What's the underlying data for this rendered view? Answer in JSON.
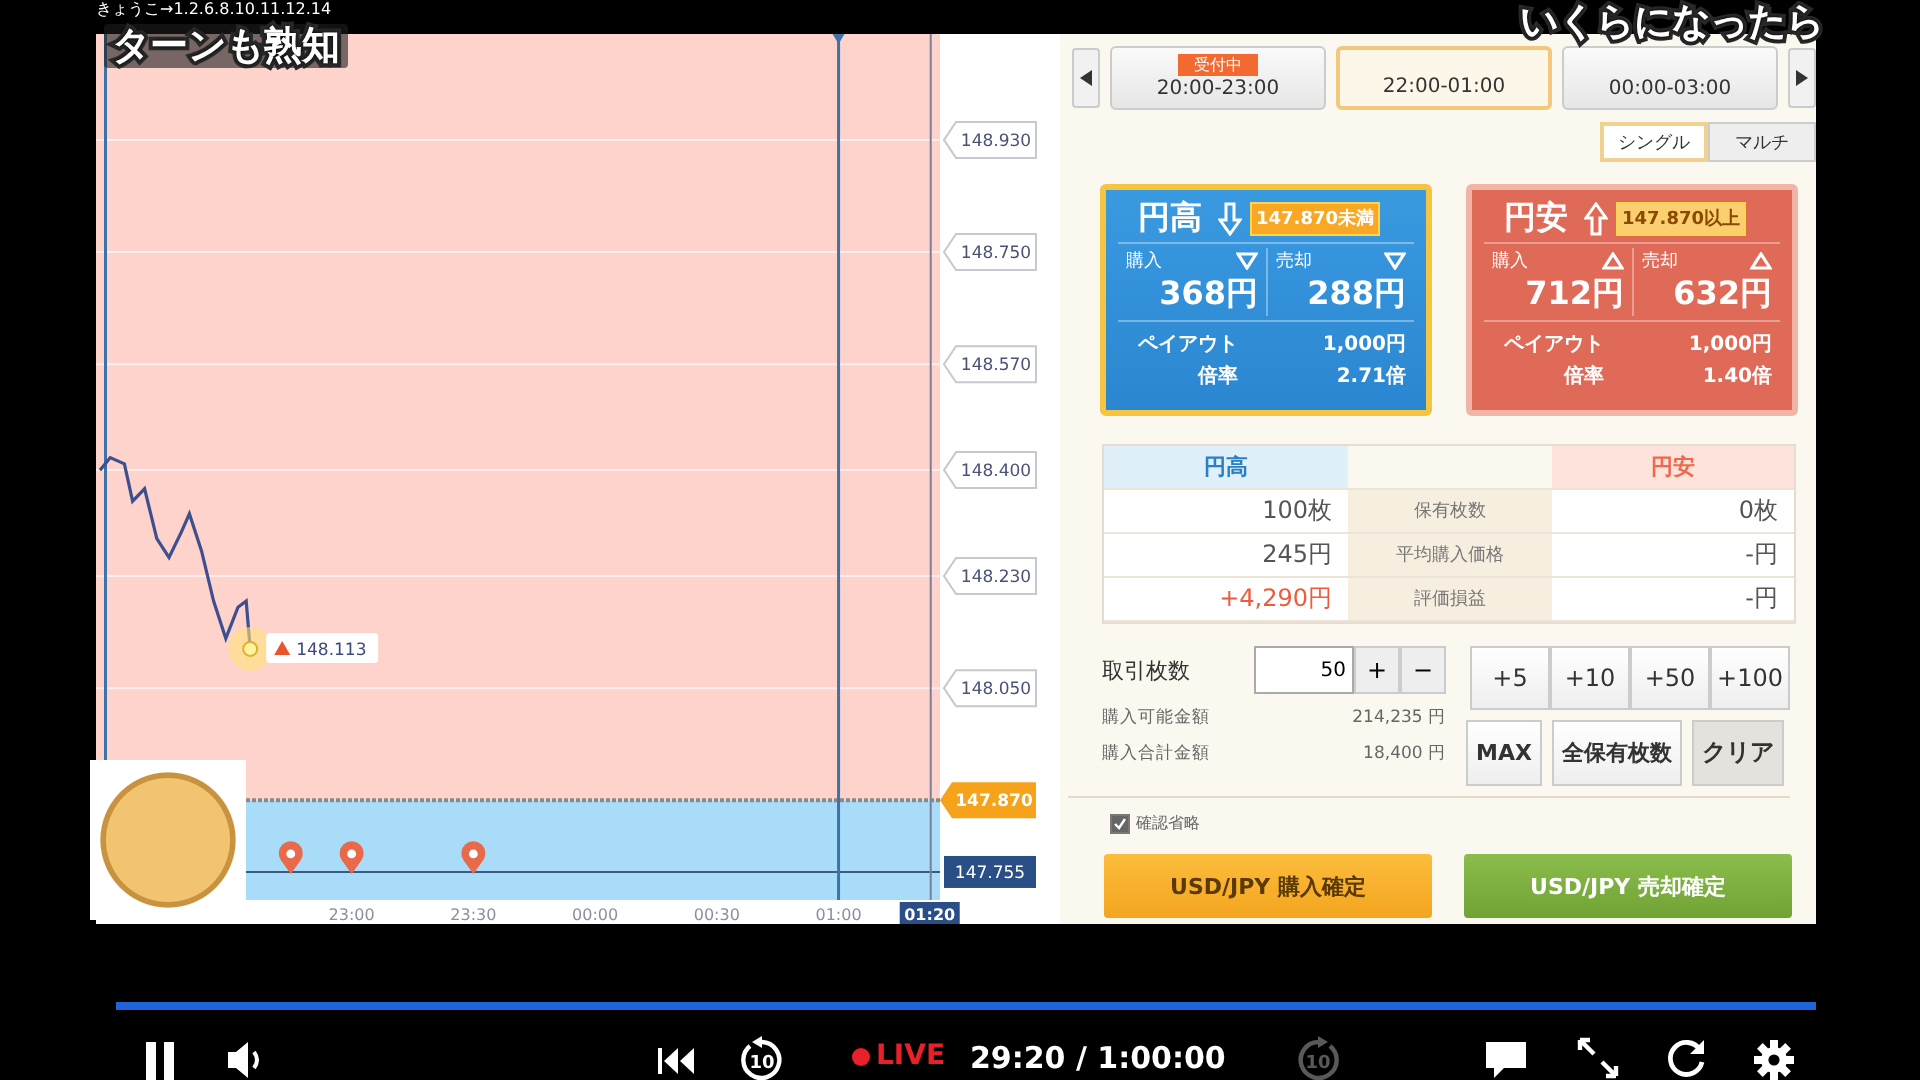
{
  "header_text": "きょうこ→1.2.6.8.10.11.12.14",
  "captions": [
    "ターンも熟知",
    "いくらになったら"
  ],
  "chart": {
    "price_labels": [
      "148.930",
      "148.750",
      "148.570",
      "148.400",
      "148.230",
      "148.050"
    ],
    "strike_label": "147.870",
    "current_label": "147.755",
    "point_label": "148.113",
    "time_labels": [
      "23:00",
      "23:30",
      "00:00",
      "00:30",
      "01:00"
    ],
    "now_label": "01:20"
  },
  "trade_panel": {
    "slots": [
      {
        "badge": "受付中",
        "time": "20:00-23:00",
        "selected": false
      },
      {
        "time": "22:00-01:00",
        "selected": true
      },
      {
        "time": "00:00-03:00",
        "selected": false
      }
    ],
    "modes": [
      {
        "label": "シングル",
        "selected": true
      },
      {
        "label": "マルチ",
        "selected": false
      }
    ],
    "options": [
      {
        "kind": "down",
        "title": "円高",
        "threshold": "147.870未満",
        "selected": true,
        "buy_label": "購入",
        "sell_label": "売却",
        "buy_price": "368円",
        "sell_price": "288円",
        "payout_label": "ペイアウト",
        "payout": "1,000円",
        "rate_label": "倍率",
        "rate": "2.71倍"
      },
      {
        "kind": "up",
        "title": "円安",
        "threshold": "147.870以上",
        "selected": false,
        "buy_label": "購入",
        "sell_label": "売却",
        "buy_price": "712円",
        "sell_price": "632円",
        "payout_label": "ペイアウト",
        "payout": "1,000円",
        "rate_label": "倍率",
        "rate": "1.40倍"
      }
    ],
    "holdings": {
      "headers": [
        "円高",
        "円安"
      ],
      "rows": [
        {
          "left": "100枚",
          "label": "保有枚数",
          "right": "0枚",
          "gain": false
        },
        {
          "left": "245円",
          "label": "平均購入価格",
          "right": "-円",
          "gain": false
        },
        {
          "left": "+4,290円",
          "label": "評価損益",
          "right": "-円",
          "gain": true
        }
      ]
    },
    "quantity": {
      "label": "取引枚数",
      "value": "50",
      "plus": "+",
      "minus": "−"
    },
    "amounts": [
      {
        "label": "購入可能金額",
        "value": "214,235 円"
      },
      {
        "label": "購入合計金額",
        "value": "18,400 円"
      }
    ],
    "quick_buttons": [
      "+5",
      "+10",
      "+50",
      "+100"
    ],
    "actions": [
      {
        "label": "MAX",
        "kind": "plain"
      },
      {
        "label": "全保有枚数",
        "kind": "plain"
      },
      {
        "label": "クリア",
        "kind": "clear"
      }
    ],
    "skip_confirm": {
      "label": "確認省略",
      "checked": true
    },
    "submit_buttons": [
      {
        "label": "USD/JPY 購入確定",
        "kind": "buy"
      },
      {
        "label": "USD/JPY 売却確定",
        "kind": "sell"
      }
    ]
  },
  "player": {
    "progress": {
      "level": 1.0
    },
    "back_label": "10",
    "live": "LIVE",
    "time": "29:20 / 1:00:00",
    "forward_label": "10",
    "forward_disabled": true
  }
}
